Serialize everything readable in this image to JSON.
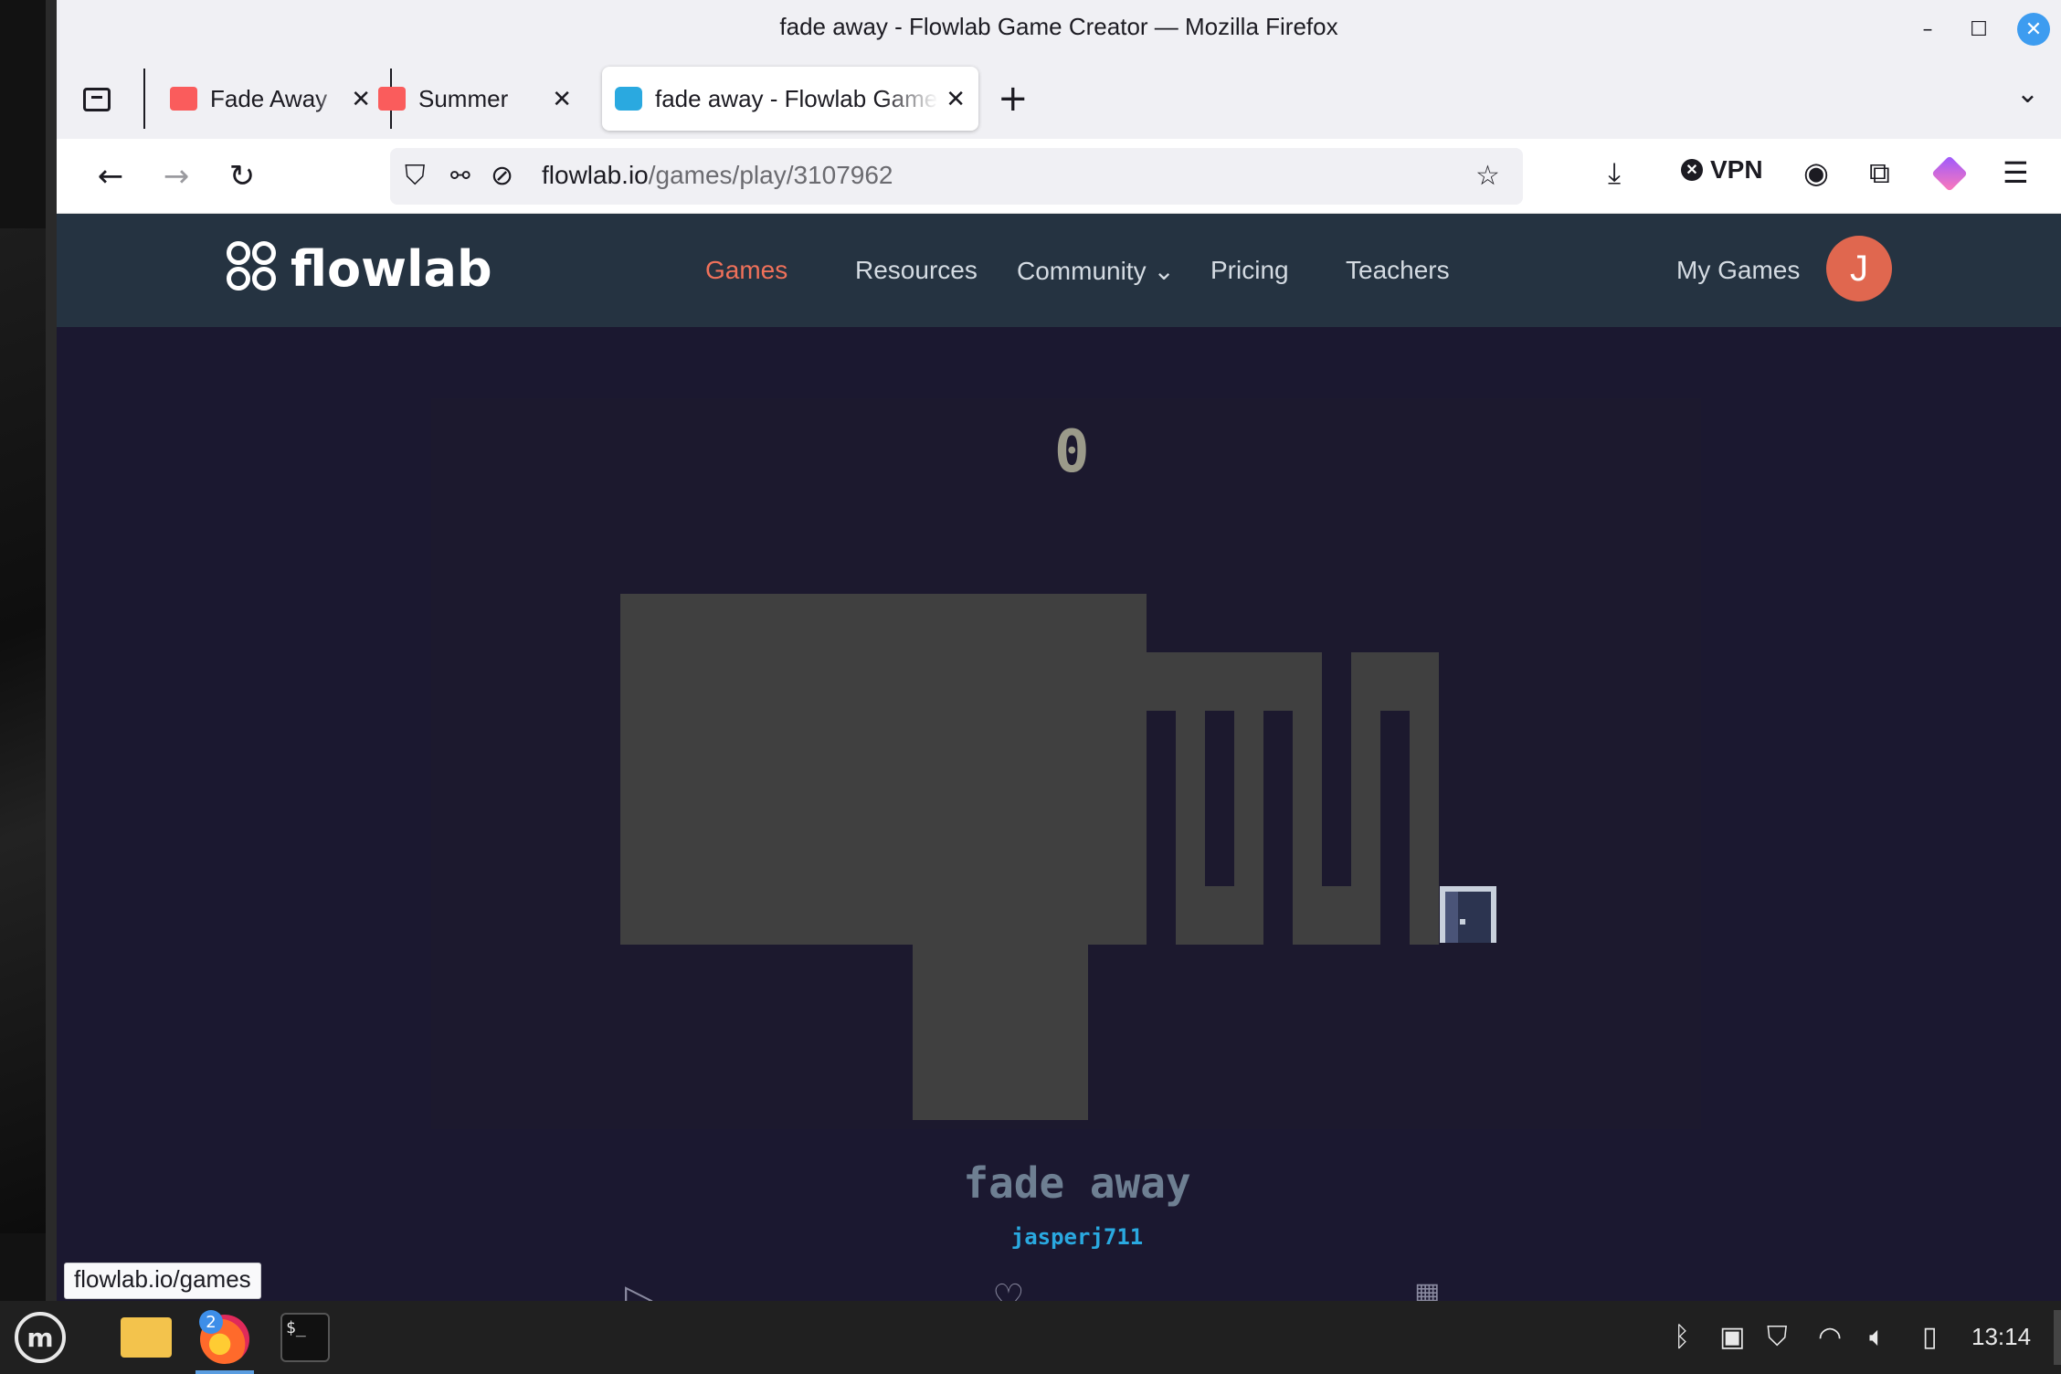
{
  "window": {
    "title": "fade away - Flowlab Game Creator — Mozilla Firefox",
    "minimize_glyph": "–",
    "maximize_glyph": "☐",
    "close_glyph": "✕"
  },
  "tabs": [
    {
      "label": "Fade Away",
      "favicon": "itch-icon",
      "active": false
    },
    {
      "label": "Summer",
      "favicon": "itch-icon",
      "active": false
    },
    {
      "label": "fade away - Flowlab Game Creator",
      "favicon": "flowlab-icon",
      "active": true
    }
  ],
  "tab_close_glyph": "✕",
  "new_tab_glyph": "+",
  "overflow_glyph": "⌄",
  "navbar": {
    "back_glyph": "←",
    "forward_glyph": "→",
    "reload_glyph": "↻",
    "url_host": "flowlab.io",
    "url_path": "/games/play/3107962",
    "bookmark_glyph": "☆",
    "vpn_label": "VPN"
  },
  "site": {
    "logo_text": "flowlab",
    "nav": [
      {
        "label": "Games",
        "active": true
      },
      {
        "label": "Resources",
        "active": false
      },
      {
        "label": "Community",
        "active": false
      },
      {
        "label": "Pricing",
        "active": false
      },
      {
        "label": "Teachers",
        "active": false
      }
    ],
    "community_chevron": "⌄",
    "my_games": "My Games",
    "avatar_initial": "J"
  },
  "game": {
    "score": "0",
    "title": "fade away",
    "author": "jasperj711"
  },
  "status_tip": "flowlab.io/games",
  "taskbar": {
    "firefox_badge": "2",
    "terminal_prompt": "$_",
    "clock": "13:14"
  },
  "colors": {
    "site_header": "#253341",
    "nav_active": "#f0715a",
    "game_bg": "#1b1830",
    "platform": "#404040",
    "author": "#2aa9e0",
    "avatar": "#e0674f"
  }
}
